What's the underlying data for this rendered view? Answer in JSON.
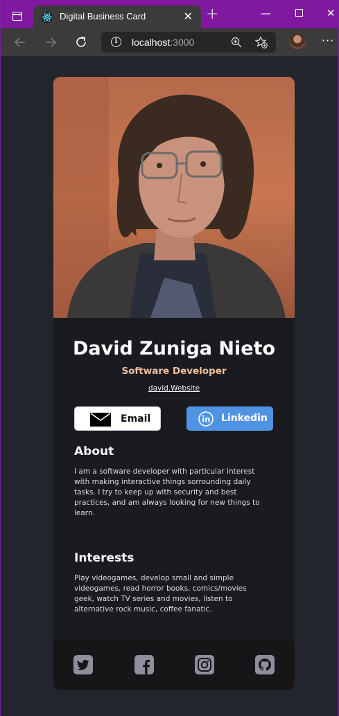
{
  "browser": {
    "tab_title": "Digital Business Card",
    "address_host": "localhost",
    "address_port": ":3000"
  },
  "card": {
    "name": "David Zuniga Nieto",
    "role": "Software Developer",
    "website": "david.Website",
    "buttons": {
      "email_label": "Email",
      "linkedin_label": "Linkedin"
    },
    "about": {
      "title": "About",
      "body": "I am a software developer with particular interest with making interactive things sorrounding daily tasks. I try to keep up with security and best practices, and am always looking for new things to learn."
    },
    "interests": {
      "title": "Interests",
      "body": "Play videogames, develop small and simple videogames, read horror books, comics/movies geek, watch TV series and movies, listen to alternative rock music, coffee fanatic."
    },
    "social": [
      "twitter-icon",
      "facebook-icon",
      "instagram-icon",
      "github-icon"
    ]
  },
  "colors": {
    "role": "#f3bf99",
    "linkedin": "#5093e2",
    "page_bg": "#23252c",
    "card_bg": "#1a1b21"
  }
}
